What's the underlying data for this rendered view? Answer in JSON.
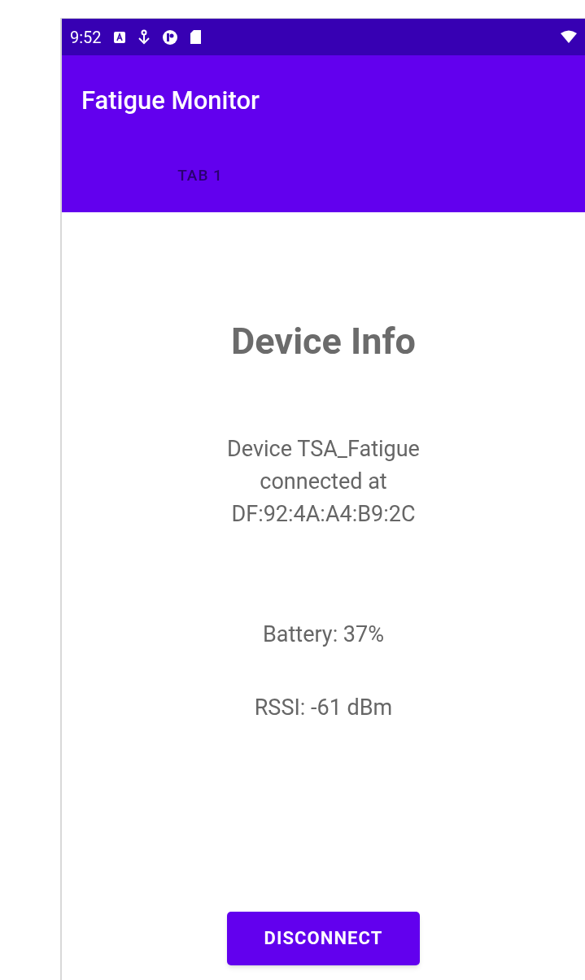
{
  "status_bar": {
    "time": "9:52"
  },
  "app_bar": {
    "title": "Fatigue Monitor"
  },
  "tabs": [
    {
      "label": "TAB 1",
      "selected": true
    }
  ],
  "content": {
    "heading": "Device Info",
    "connection_lines": [
      "Device TSA_Fatigue",
      "connected at",
      "DF:92:4A:A4:B9:2C"
    ],
    "battery": "Battery: 37%",
    "rssi": "RSSI: -61 dBm",
    "button": "DISCONNECT"
  }
}
